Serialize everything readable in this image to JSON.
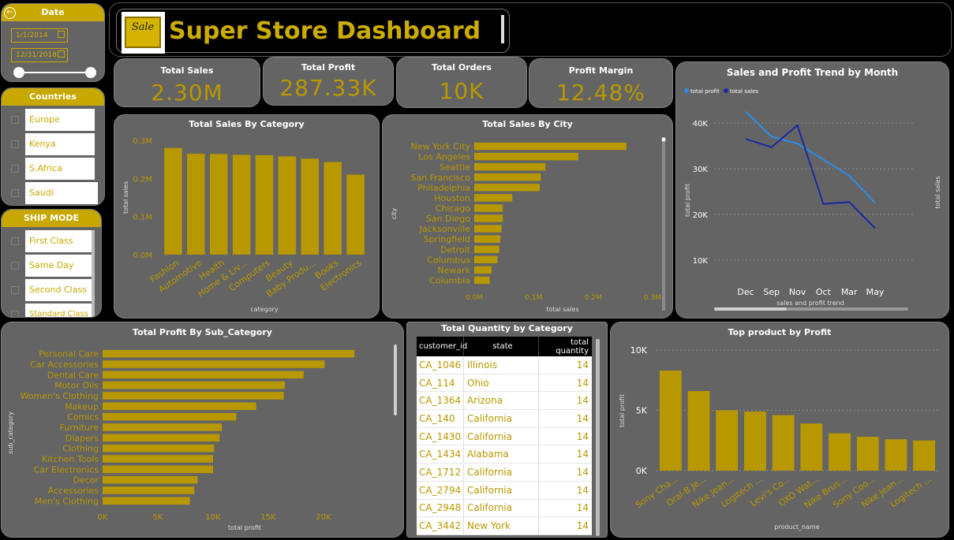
{
  "header": {
    "title": "Super Store Dashboard",
    "logo_text": "Sale"
  },
  "date_slicer": {
    "title": "Date",
    "start": "1/1/2014",
    "end": "12/31/2018"
  },
  "countries_slicer": {
    "title": "Countries",
    "options": [
      "Europe",
      "Kenya",
      "S.Africa",
      "Saudi"
    ]
  },
  "shipmode_slicer": {
    "title": "SHIP MODE",
    "options": [
      "First Class",
      "Same Day",
      "Second Class",
      "Standard Class"
    ]
  },
  "kpis": [
    {
      "label": "Total Sales",
      "value": "2.30M"
    },
    {
      "label": "Total Profit",
      "value": "287.33K"
    },
    {
      "label": "Total Orders",
      "value": "10K"
    },
    {
      "label": "Profit Margin",
      "value": "12.48%"
    }
  ],
  "colors": {
    "gold": "#b89800",
    "panel": "#646464",
    "light_blue": "#2a8de8",
    "dark_blue": "#1a2aa0"
  },
  "chart_data": [
    {
      "type": "bar",
      "title": "Total Sales By Category",
      "xlabel": "category",
      "ylabel": "total sales",
      "yticks": [
        "0.0M",
        "0.1M",
        "0.2M",
        "0.3M"
      ],
      "ylim": [
        0,
        0.3
      ],
      "categories": [
        "Fashion",
        "Automotive",
        "Health",
        "Home & Liv...",
        "Computers",
        "Beauty",
        "Baby Produ...",
        "Books",
        "Electronics"
      ],
      "values": [
        0.28,
        0.265,
        0.264,
        0.262,
        0.261,
        0.258,
        0.252,
        0.243,
        0.21
      ]
    },
    {
      "type": "bar",
      "orientation": "horizontal",
      "title": "Total Sales By City",
      "xlabel": "total sales",
      "ylabel": "city",
      "xticks": [
        "0.0M",
        "0.1M",
        "0.2M",
        "0.3M"
      ],
      "xlim": [
        0,
        0.3
      ],
      "categories": [
        "New York City",
        "Los Angeles",
        "Seattle",
        "San Francisco",
        "Philadelphia",
        "Houston",
        "Chicago",
        "San Diego",
        "Jacksonville",
        "Springfield",
        "Detroit",
        "Columbus",
        "Newark",
        "Columbia"
      ],
      "values": [
        0.256,
        0.175,
        0.12,
        0.112,
        0.11,
        0.064,
        0.048,
        0.048,
        0.046,
        0.044,
        0.042,
        0.039,
        0.029,
        0.026
      ]
    },
    {
      "type": "line",
      "title": "Sales and Profit Trend by Month",
      "xlabel": "sales and profit trend",
      "ylabel": "total profit",
      "y2label": "total sales",
      "yticks": [
        "10K",
        "20K",
        "30K",
        "40K"
      ],
      "ylim": [
        5000,
        45000
      ],
      "categories": [
        "Dec",
        "Sep",
        "Nov",
        "Oct",
        "Mar",
        "May"
      ],
      "legend": "top-left",
      "series": [
        {
          "name": "total profit",
          "values": [
            42500,
            37000,
            35500,
            32000,
            28500,
            22500
          ]
        },
        {
          "name": "total sales",
          "values": [
            36500,
            34700,
            39500,
            22300,
            22700,
            17000
          ]
        }
      ]
    },
    {
      "type": "bar",
      "orientation": "horizontal",
      "title": "Total Profit By Sub_Category",
      "xlabel": "total profit",
      "ylabel": "sub_category",
      "xticks": [
        "0K",
        "5K",
        "10K",
        "15K",
        "20K"
      ],
      "xlim": [
        0,
        25000
      ],
      "categories": [
        "Personal Care",
        "Car Accessories",
        "Dental Care",
        "Motor Oils",
        "Women's Clothing",
        "Makeup",
        "Comics",
        "Furniture",
        "Diapers",
        "Clothing",
        "Kitchen Tools",
        "Car Electronics",
        "Decor",
        "Accessories",
        "Men's Clothing"
      ],
      "values": [
        22800,
        20100,
        18200,
        16500,
        16400,
        13900,
        12100,
        10800,
        10600,
        10100,
        10000,
        10000,
        8600,
        8300,
        7900
      ]
    },
    {
      "type": "bar",
      "title": "Top product by Profit",
      "xlabel": "product_name",
      "ylabel": "total profit",
      "yticks": [
        "0K",
        "5K",
        "10K"
      ],
      "ylim": [
        0,
        10000
      ],
      "categories": [
        "Sony Cha...",
        "Oral-B Je...",
        "Nike Jean...",
        "Logitech ...",
        "Levi's Co...",
        "OXO Wat...",
        "Nike Brus...",
        "Sony Coo...",
        "Nike Jean...",
        "Logitech ..."
      ],
      "values": [
        8300,
        6600,
        5000,
        4900,
        4600,
        3900,
        3100,
        2800,
        2600,
        2500
      ]
    }
  ],
  "table": {
    "title": "Total Quantity by Category",
    "columns": [
      "customer_id",
      "state",
      "total quantity"
    ],
    "rows": [
      [
        "CA_1046",
        "Illinois",
        "14"
      ],
      [
        "CA_114",
        "Ohio",
        "14"
      ],
      [
        "CA_1364",
        "Arizona",
        "14"
      ],
      [
        "CA_140",
        "California",
        "14"
      ],
      [
        "CA_1430",
        "California",
        "14"
      ],
      [
        "CA_1434",
        "Alabama",
        "14"
      ],
      [
        "CA_1712",
        "California",
        "14"
      ],
      [
        "CA_2794",
        "California",
        "14"
      ],
      [
        "CA_2948",
        "California",
        "14"
      ],
      [
        "CA_3442",
        "New York",
        "14"
      ]
    ]
  }
}
